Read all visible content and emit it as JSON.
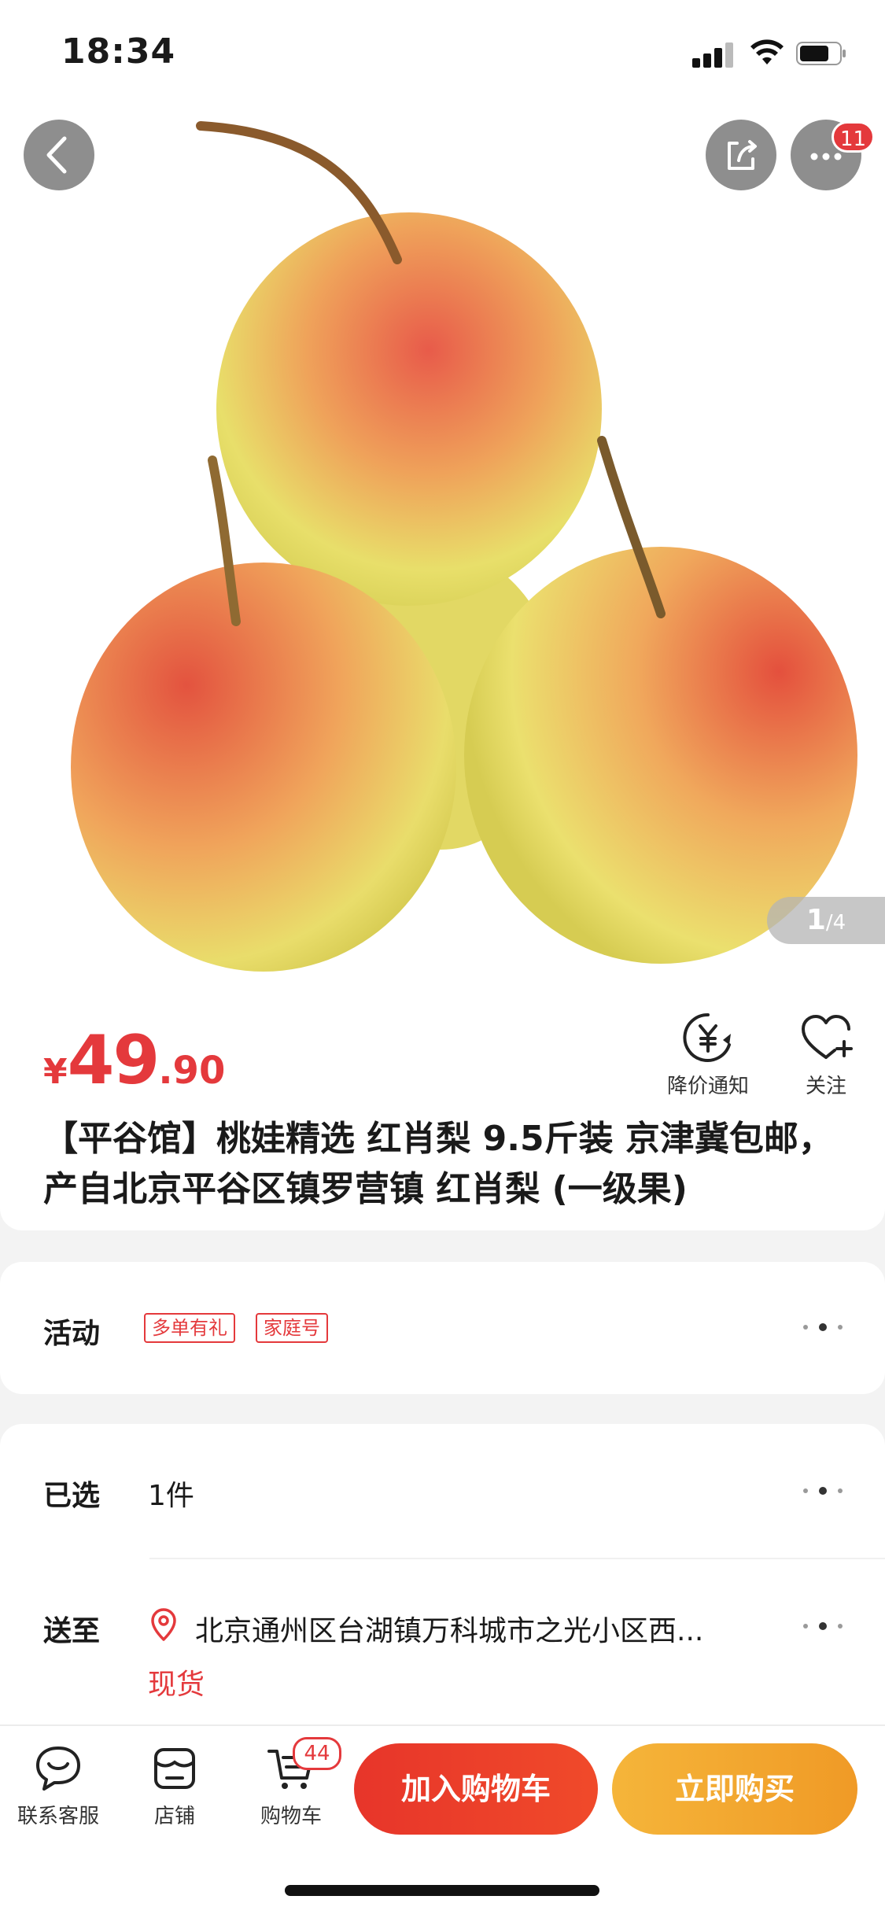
{
  "status_bar": {
    "time": "18:34"
  },
  "hero": {
    "pager_current": "1",
    "pager_total": "/4",
    "more_badge": "11"
  },
  "price": {
    "currency": "¥",
    "integer": "49",
    "decimal": ".90",
    "color": "#e4393c"
  },
  "actions": {
    "price_alert_label": "降价通知",
    "follow_label": "关注"
  },
  "product_title": "【平谷馆】桃娃精选 红肖梨 9.5斤装 京津冀包邮，产自北京平谷区镇罗营镇 红肖梨 (一级果)",
  "promo": {
    "label": "活动",
    "tags": [
      "多单有礼",
      "家庭号"
    ]
  },
  "selection": {
    "label": "已选",
    "value": "1件"
  },
  "delivery": {
    "label": "送至",
    "address": "北京通州区台湖镇万科城市之光小区西...",
    "stock": "现货"
  },
  "bottom_bar": {
    "service_label": "联系客服",
    "shop_label": "店铺",
    "cart_label": "购物车",
    "cart_count": "44",
    "add_to_cart": "加入购物车",
    "buy_now": "立即购买"
  },
  "icons": [
    "back-icon",
    "share-icon",
    "more-icon",
    "price-alert-icon",
    "heart-plus-icon",
    "location-icon",
    "chat-icon",
    "shop-icon",
    "cart-icon"
  ]
}
